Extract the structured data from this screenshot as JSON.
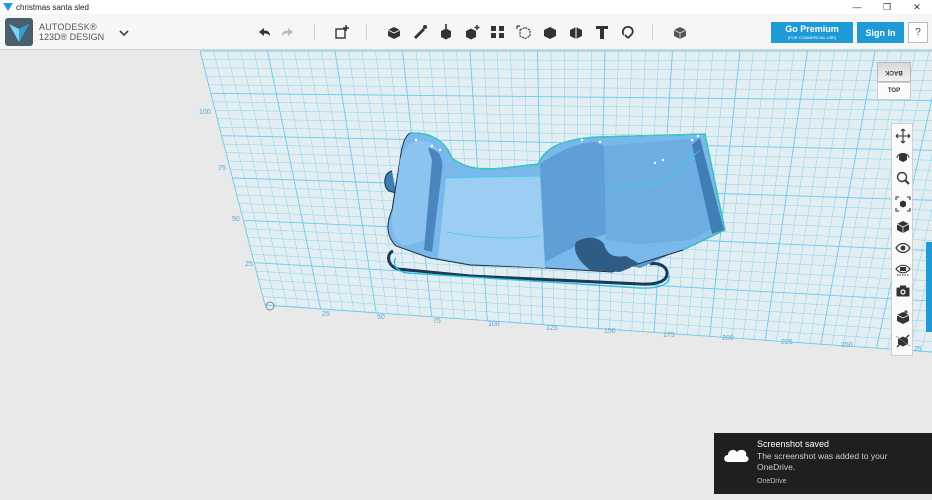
{
  "window": {
    "title": "christmas santa sled",
    "controls": [
      "—",
      "❐",
      "✕"
    ]
  },
  "brand": {
    "line1": "AUTODESK®",
    "line2": "123D® DESIGN"
  },
  "toolbar": {
    "icons": [
      "undo-icon",
      "redo-icon",
      "add-primitive-icon",
      "primitives-icon",
      "sketch-icon",
      "construct-icon",
      "modify-icon",
      "pattern-icon",
      "group-icon",
      "combine-icon",
      "measure-icon",
      "text-icon",
      "snap-icon",
      "material-icon"
    ],
    "go_premium": "Go Premium",
    "go_premium_sub": "(FOR COMMERCIAL USE)",
    "sign_in": "Sign In",
    "help": "?"
  },
  "viewcube": {
    "face_back": "BACK",
    "face_top": "TOP"
  },
  "grid": {
    "x_ticks": [
      "25",
      "50",
      "75",
      "100",
      "125",
      "150",
      "175",
      "200",
      "225",
      "250"
    ],
    "y_ticks": [
      "25",
      "50",
      "75",
      "100"
    ],
    "x_end_label": "25"
  },
  "navbar": [
    "pan-icon",
    "orbit-icon",
    "zoom-icon",
    "fit-icon",
    "materials-outlines-icon",
    "visibility-icon",
    "hidden-objects-icon",
    "camera-icon",
    "mesh-icon",
    "snap-grid-icon"
  ],
  "toast": {
    "title": "Screenshot saved",
    "body": "The screenshot was added to your OneDrive.",
    "source": "OneDrive"
  },
  "colors": {
    "accent": "#1e9ad6",
    "grid": "#66c7ef",
    "model": "#78b7e8",
    "model_dark": "#4f90c6"
  }
}
